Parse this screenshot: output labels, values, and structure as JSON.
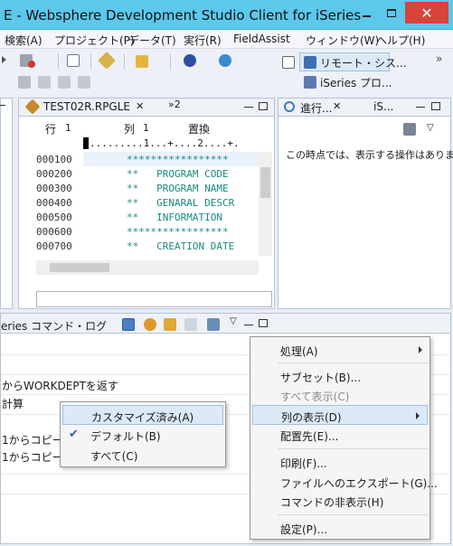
{
  "window": {
    "title": "E - Websphere Development Studio Client for iSeries",
    "close_glyph": "✕"
  },
  "menubar": {
    "items": [
      "検索(A)",
      "プロジェクト(P)",
      "データ(T)",
      "実行(R)",
      "FieldAssist",
      "ウィンドウ(W)",
      "ヘルプ(H)"
    ]
  },
  "perspectives": {
    "remote": "リモート・シス...",
    "iseries": "iSeries プロ...",
    "more": "»"
  },
  "editor": {
    "tab_label": "TEST02R.RPGLE",
    "overflow_label": "»2",
    "status_row": "行",
    "status_row_val": "1",
    "status_col": "列",
    "status_col_val": "1",
    "status_mode": "置換",
    "ruler": ".........1...+....2....+.",
    "lines": [
      {
        "seq": "000100",
        "code": "*****************"
      },
      {
        "seq": "000200",
        "code": "**   PROGRAM CODE"
      },
      {
        "seq": "000300",
        "code": "**   PROGRAM NAME"
      },
      {
        "seq": "000400",
        "code": "**   GENARAL DESCR"
      },
      {
        "seq": "000500",
        "code": "**   INFORMATION"
      },
      {
        "seq": "000600",
        "code": "*****************"
      },
      {
        "seq": "000700",
        "code": "**   CREATION DATE"
      }
    ]
  },
  "progress_view": {
    "tab_label": "進行...",
    "tab2_label": "iS...",
    "message": "この時点では、表示する操作はありま"
  },
  "command_log": {
    "tab_label": "eries コマンド・ログ",
    "rows": [
      "からWORKDEPTを返す",
      "計算",
      "1からコピーし",
      "1からコピーし"
    ]
  },
  "context_menu": {
    "items": [
      {
        "label": "処理(A)",
        "submenu": true,
        "disabled": false
      },
      {
        "label": "サブセット(B)...",
        "submenu": false,
        "disabled": false
      },
      {
        "label": "すべて表示(C)",
        "submenu": false,
        "disabled": true
      },
      {
        "label": "列の表示(D)",
        "submenu": true,
        "disabled": false,
        "highlighted": true
      },
      {
        "label": "配置先(E)...",
        "submenu": false,
        "disabled": false
      },
      {
        "label": "印刷(F)...",
        "submenu": false,
        "disabled": false
      },
      {
        "label": "ファイルへのエクスポート(G)...",
        "submenu": false,
        "disabled": false
      },
      {
        "label": "コマンドの非表示(H)",
        "submenu": false,
        "disabled": false
      },
      {
        "label": "設定(P)...",
        "submenu": false,
        "disabled": false
      }
    ]
  },
  "submenu": {
    "items": [
      {
        "label": "カスタマイズ済み(A)",
        "highlighted": true
      },
      {
        "label": "デフォルト(B)",
        "checked": true,
        "check_glyph": "✔"
      },
      {
        "label": "すべて(C)"
      }
    ]
  },
  "colors": {
    "titlebar": "#5cc8ec",
    "close": "#d9433a",
    "highlight": "#dce9f7",
    "code": "#1a8a7e"
  }
}
